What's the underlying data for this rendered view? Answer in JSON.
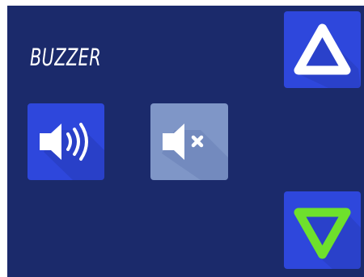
{
  "panel": {
    "title": "BUZZER"
  },
  "buttons": {
    "sound_on": {
      "icon": "speaker-on-icon"
    },
    "sound_off": {
      "icon": "speaker-mute-icon"
    },
    "up": {
      "icon": "triangle-up-icon"
    },
    "down": {
      "icon": "triangle-down-icon"
    }
  },
  "colors": {
    "background": "#1b2a6b",
    "button": "#2e47dc",
    "button_disabled": "#7f96c7",
    "down_arrow": "#6ee02c",
    "icon": "#ffffff"
  }
}
